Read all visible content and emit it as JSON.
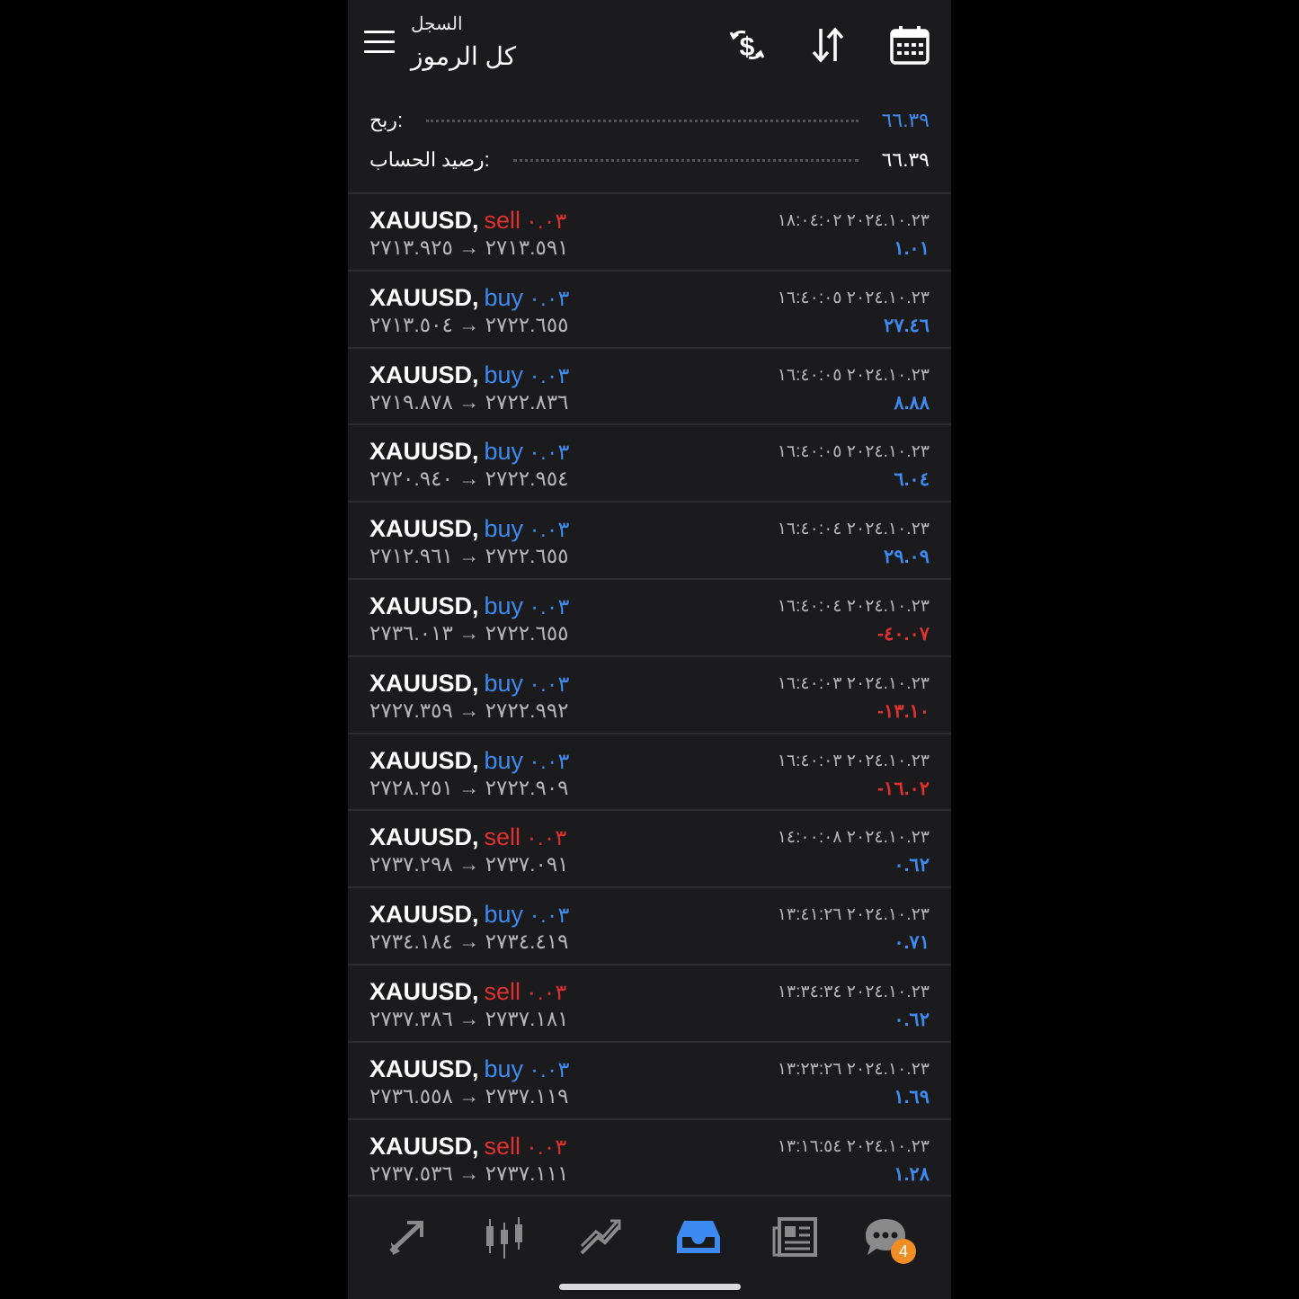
{
  "header": {
    "subtitle": "السجل",
    "title": "كل الرموز",
    "icons": [
      "menu-icon",
      "deposit-withdraw-icon",
      "sort-icon",
      "calendar-icon"
    ]
  },
  "summary": {
    "profit_label": "ربح:",
    "profit_value": "٦٦.٣٩",
    "balance_label": "رصيد الحساب:",
    "balance_value": "٦٦.٣٩"
  },
  "colors": {
    "buy": "#3d8bf0",
    "sell": "#e0312f",
    "accent": "#3d8bf0",
    "badge": "#f08d24"
  },
  "deals": [
    {
      "symbol": "XAUUSD,",
      "side": "sell",
      "volume": "٠.٠٣",
      "open": "٢٧١٣.٥٩١",
      "arrow": "→",
      "close": "٢٧١٣.٩٢٥",
      "time": "٢٠٢٤.١٠.٢٣ ١٨:٠٤:٠٢",
      "profit": "١.٠١",
      "profit_sign": "pos"
    },
    {
      "symbol": "XAUUSD,",
      "side": "buy",
      "volume": "٠.٠٣",
      "open": "٢٧٢٢.٦٥٥",
      "arrow": "→",
      "close": "٢٧١٣.٥٠٤",
      "time": "٢٠٢٤.١٠.٢٣ ١٦:٤٠:٠٥",
      "profit": "٢٧.٤٦",
      "profit_sign": "pos"
    },
    {
      "symbol": "XAUUSD,",
      "side": "buy",
      "volume": "٠.٠٣",
      "open": "٢٧٢٢.٨٣٦",
      "arrow": "→",
      "close": "٢٧١٩.٨٧٨",
      "time": "٢٠٢٤.١٠.٢٣ ١٦:٤٠:٠٥",
      "profit": "٨.٨٨",
      "profit_sign": "pos"
    },
    {
      "symbol": "XAUUSD,",
      "side": "buy",
      "volume": "٠.٠٣",
      "open": "٢٧٢٢.٩٥٤",
      "arrow": "→",
      "close": "٢٧٢٠.٩٤٠",
      "time": "٢٠٢٤.١٠.٢٣ ١٦:٤٠:٠٥",
      "profit": "٦.٠٤",
      "profit_sign": "pos"
    },
    {
      "symbol": "XAUUSD,",
      "side": "buy",
      "volume": "٠.٠٣",
      "open": "٢٧٢٢.٦٥٥",
      "arrow": "→",
      "close": "٢٧١٢.٩٦١",
      "time": "٢٠٢٤.١٠.٢٣ ١٦:٤٠:٠٤",
      "profit": "٢٩.٠٩",
      "profit_sign": "pos"
    },
    {
      "symbol": "XAUUSD,",
      "side": "buy",
      "volume": "٠.٠٣",
      "open": "٢٧٢٢.٦٥٥",
      "arrow": "→",
      "close": "٢٧٣٦.٠١٣",
      "time": "٢٠٢٤.١٠.٢٣ ١٦:٤٠:٠٤",
      "profit": "-٤٠.٠٧",
      "profit_sign": "neg"
    },
    {
      "symbol": "XAUUSD,",
      "side": "buy",
      "volume": "٠.٠٣",
      "open": "٢٧٢٢.٩٩٢",
      "arrow": "→",
      "close": "٢٧٢٧.٣٥٩",
      "time": "٢٠٢٤.١٠.٢٣ ١٦:٤٠:٠٣",
      "profit": "-١٣.١٠",
      "profit_sign": "neg"
    },
    {
      "symbol": "XAUUSD,",
      "side": "buy",
      "volume": "٠.٠٣",
      "open": "٢٧٢٢.٩٠٩",
      "arrow": "→",
      "close": "٢٧٢٨.٢٥١",
      "time": "٢٠٢٤.١٠.٢٣ ١٦:٤٠:٠٣",
      "profit": "-١٦.٠٢",
      "profit_sign": "neg"
    },
    {
      "symbol": "XAUUSD,",
      "side": "sell",
      "volume": "٠.٠٣",
      "open": "٢٧٣٧.٠٩١",
      "arrow": "→",
      "close": "٢٧٣٧.٢٩٨",
      "time": "٢٠٢٤.١٠.٢٣ ١٤:٠٠:٠٨",
      "profit": "٠.٦٢",
      "profit_sign": "pos"
    },
    {
      "symbol": "XAUUSD,",
      "side": "buy",
      "volume": "٠.٠٣",
      "open": "٢٧٣٤.٤١٩",
      "arrow": "→",
      "close": "٢٧٣٤.١٨٤",
      "time": "٢٠٢٤.١٠.٢٣ ١٣:٤١:٢٦",
      "profit": "٠.٧١",
      "profit_sign": "pos"
    },
    {
      "symbol": "XAUUSD,",
      "side": "sell",
      "volume": "٠.٠٣",
      "open": "٢٧٣٧.١٨١",
      "arrow": "→",
      "close": "٢٧٣٧.٣٨٦",
      "time": "٢٠٢٤.١٠.٢٣ ١٣:٣٤:٣٤",
      "profit": "٠.٦٢",
      "profit_sign": "pos"
    },
    {
      "symbol": "XAUUSD,",
      "side": "buy",
      "volume": "٠.٠٣",
      "open": "٢٧٣٧.١١٩",
      "arrow": "→",
      "close": "٢٧٣٦.٥٥٨",
      "time": "٢٠٢٤.١٠.٢٣ ١٣:٢٣:٢٦",
      "profit": "١.٦٩",
      "profit_sign": "pos"
    },
    {
      "symbol": "XAUUSD,",
      "side": "sell",
      "volume": "٠.٠٣",
      "open": "٢٧٣٧.١١١",
      "arrow": "→",
      "close": "٢٧٣٧.٥٣٦",
      "time": "٢٠٢٤.١٠.٢٣ ١٣:١٦:٥٤",
      "profit": "١.٢٨",
      "profit_sign": "pos"
    }
  ],
  "tabbar": {
    "tabs": [
      "trade-icon",
      "quotes-icon",
      "chart-icon",
      "history-icon",
      "news-icon",
      "messages-icon"
    ],
    "active": "history-icon",
    "messages_badge": "4"
  }
}
